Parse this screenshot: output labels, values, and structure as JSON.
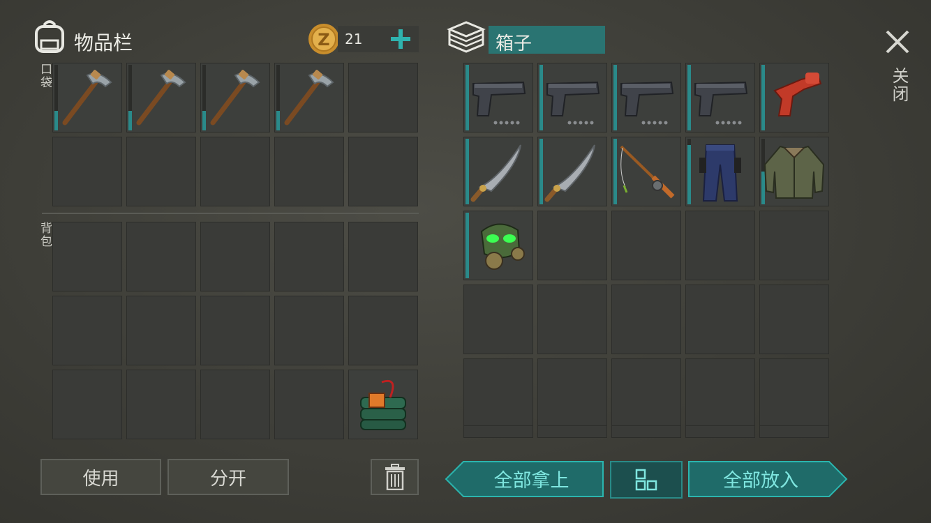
{
  "inventory": {
    "title": "物品栏",
    "coins": "21",
    "pocket_label": "口袋",
    "backpack_label": "背包",
    "pocket_items": [
      "pickaxe",
      "pickaxe",
      "pickaxe",
      "pickaxe",
      "",
      "",
      "",
      "",
      "",
      ""
    ],
    "backpack_items": [
      "",
      "",
      "",
      "",
      "",
      "",
      "",
      "",
      "",
      "",
      "",
      "",
      "",
      "",
      "c4-explosive"
    ]
  },
  "box": {
    "title": "箱子",
    "items": [
      "pistol",
      "pistol",
      "pistol",
      "pistol",
      "flare-gun",
      "machete",
      "machete",
      "fishing-rod",
      "jeans",
      "jacket",
      "gas-mask",
      "",
      "",
      "",
      "",
      "",
      "",
      "",
      "",
      "",
      "",
      "",
      "",
      "",
      ""
    ]
  },
  "buttons": {
    "use": "使用",
    "split": "分开",
    "take_all": "全部拿上",
    "put_all": "全部放入"
  },
  "close_label": "关闭",
  "colors": {
    "accent_teal": "#2a8a8a",
    "teal_text": "#7fe6e0",
    "coin_gold": "#d9a440"
  }
}
